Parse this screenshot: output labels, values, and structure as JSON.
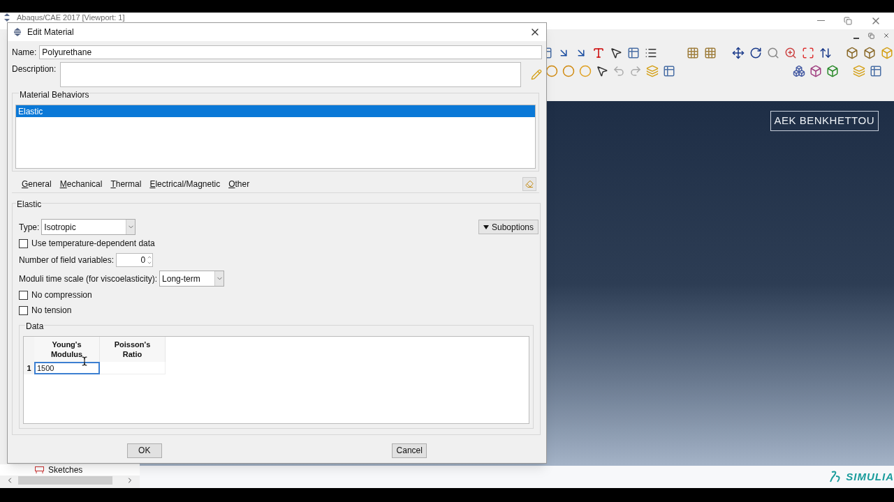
{
  "main_window": {
    "title": "Abaqus/CAE 2017 [Viewport: 1]",
    "viewport_label": "AEK BENKHETTOU",
    "brand": "SIMULIA",
    "tree_item": "Sketches"
  },
  "dialog": {
    "title": "Edit Material",
    "name_label": "Name:",
    "name_value": "Polyurethane",
    "description_label": "Description:",
    "behaviors_title": "Material Behaviors",
    "behaviors": [
      {
        "label": "Elastic",
        "selected": true
      }
    ],
    "menus": [
      "General",
      "Mechanical",
      "Thermal",
      "Electrical/Magnetic",
      "Other"
    ],
    "section_title": "Elastic",
    "type_label": "Type:",
    "type_value": "Isotropic",
    "suboptions": "Suboptions",
    "temp_dependent": {
      "label": "Use temperature-dependent data",
      "checked": false
    },
    "field_vars_label": "Number of field variables:",
    "field_vars_value": "0",
    "moduli_label": "Moduli time scale (for viscoelasticity):",
    "moduli_value": "Long-term",
    "options": [
      {
        "label": "No compression",
        "checked": false
      },
      {
        "label": "No tension",
        "checked": false
      }
    ],
    "data": {
      "title": "Data",
      "columns": [
        "Young's\nModulus",
        "Poisson's\nRatio"
      ],
      "rows": [
        {
          "index": "1",
          "values": [
            "1500"
          ],
          "editing": true
        }
      ]
    },
    "buttons": [
      "OK",
      "Cancel"
    ]
  }
}
